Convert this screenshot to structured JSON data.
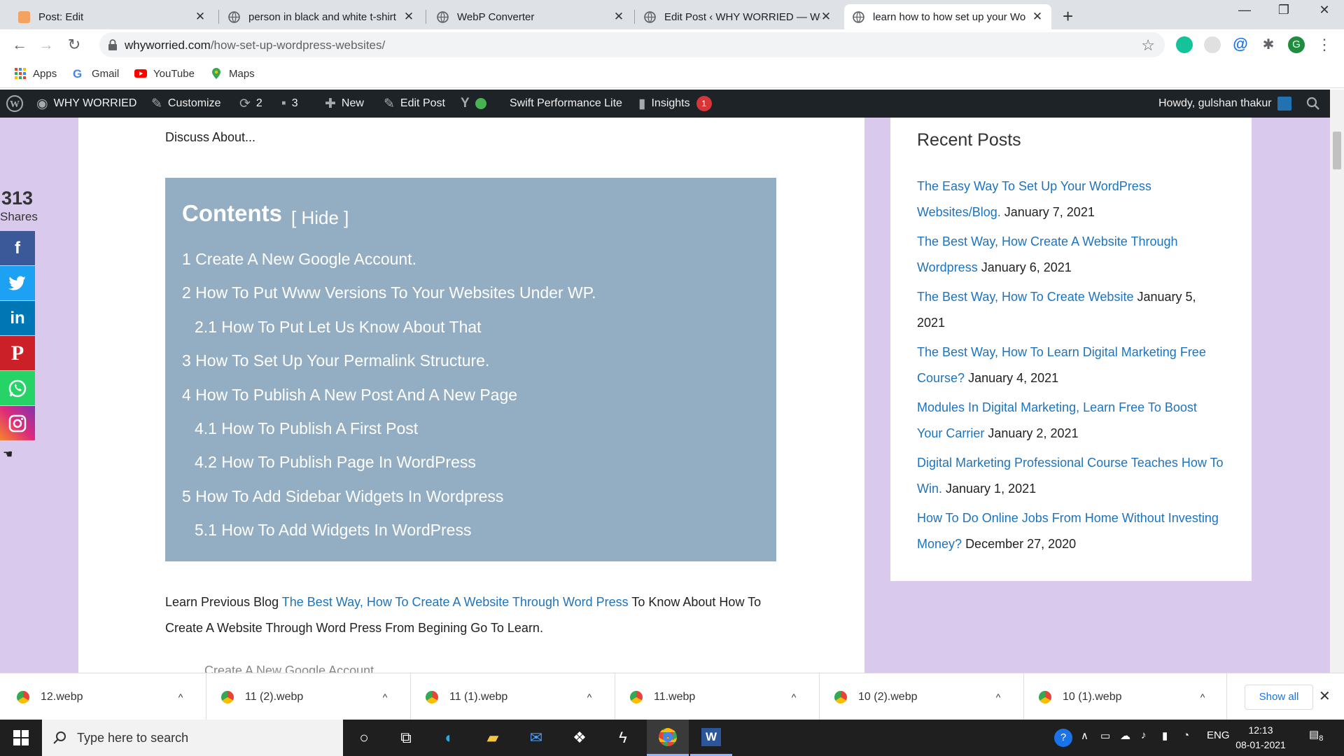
{
  "browser": {
    "tabs": [
      {
        "title": "Post: Edit"
      },
      {
        "title": "person in black and white t-shirt"
      },
      {
        "title": "WebP Converter"
      },
      {
        "title": "Edit Post ‹ WHY WORRIED — Wo"
      },
      {
        "title": "learn how to how set up your Wo"
      }
    ],
    "url_host": "whyworried.com",
    "url_path": "/how-set-up-wordpress-websites/",
    "profile_initial": "G",
    "bookmarks": [
      {
        "label": "Apps"
      },
      {
        "label": "Gmail"
      },
      {
        "label": "YouTube"
      },
      {
        "label": "Maps"
      }
    ]
  },
  "admin_bar": {
    "site_name": "WHY WORRIED",
    "customize": "Customize",
    "updates": "2",
    "comments": "3",
    "new": "New",
    "edit_post": "Edit Post",
    "swift": "Swift Performance Lite",
    "insights": "Insights",
    "insights_badge": "1",
    "howdy": "Howdy, gulshan thakur"
  },
  "article": {
    "discuss": "Discuss About...",
    "toc_title": "Contents",
    "toc_hide": "[ Hide ]",
    "toc_items": [
      "1 Create A New Google Account.",
      "2 How To Put Www Versions To Your Websites Under WP.",
      "2.1 How To Put Let Us Know About That",
      "3 How To Set Up Your Permalink Structure.",
      "4 How To Publish A New Post And A New Page",
      "4.1 How To Publish A First Post",
      "4.2 How To Publish Page In WordPress",
      "5 How To Add Sidebar Widgets In Wordpress",
      "5.1 How To Add Widgets In WordPress"
    ],
    "para_prefix": "Learn Previous Blog ",
    "para_link": "The Best Way, How To Create A Website Through Word Press",
    "para_suffix": " To Know About How To Create A Website Through Word Press From Begining Go To Learn.",
    "cut_heading": "Create A New Google Account"
  },
  "share": {
    "count": "313",
    "label": "Shares",
    "icons": [
      "facebook-icon",
      "twitter-icon",
      "linkedin-icon",
      "pinterest-icon",
      "whatsapp-icon",
      "instagram-icon"
    ]
  },
  "sidebar": {
    "title": "Recent Posts",
    "posts": [
      {
        "link": "The Easy Way To Set Up Your WordPress Websites/Blog.",
        "date": "January 7, 2021"
      },
      {
        "link": "The Best Way, How Create A Website Through Wordpress",
        "date": "January 6, 2021"
      },
      {
        "link": "The Best Way, How To Create Website",
        "date": "January 5, 2021"
      },
      {
        "link": "The Best Way, How To Learn Digital Marketing Free Course?",
        "date": "January 4, 2021"
      },
      {
        "link": "Modules In Digital Marketing, Learn Free To Boost Your Carrier",
        "date": "January 2, 2021"
      },
      {
        "link": "Digital Marketing Professional Course Teaches How To Win.",
        "date": "January 1, 2021"
      },
      {
        "link": "How To Do Online Jobs From Home Without Investing Money?",
        "date": "December 27, 2020"
      }
    ]
  },
  "downloads": {
    "files": [
      "12.webp",
      "11 (2).webp",
      "11 (1).webp",
      "11.webp",
      "10 (2).webp",
      "10 (1).webp"
    ],
    "show_all": "Show all"
  },
  "taskbar": {
    "search_placeholder": "Type here to search",
    "lang": "ENG",
    "time": "12:13",
    "date": "08-01-2021",
    "notifications": "8"
  }
}
